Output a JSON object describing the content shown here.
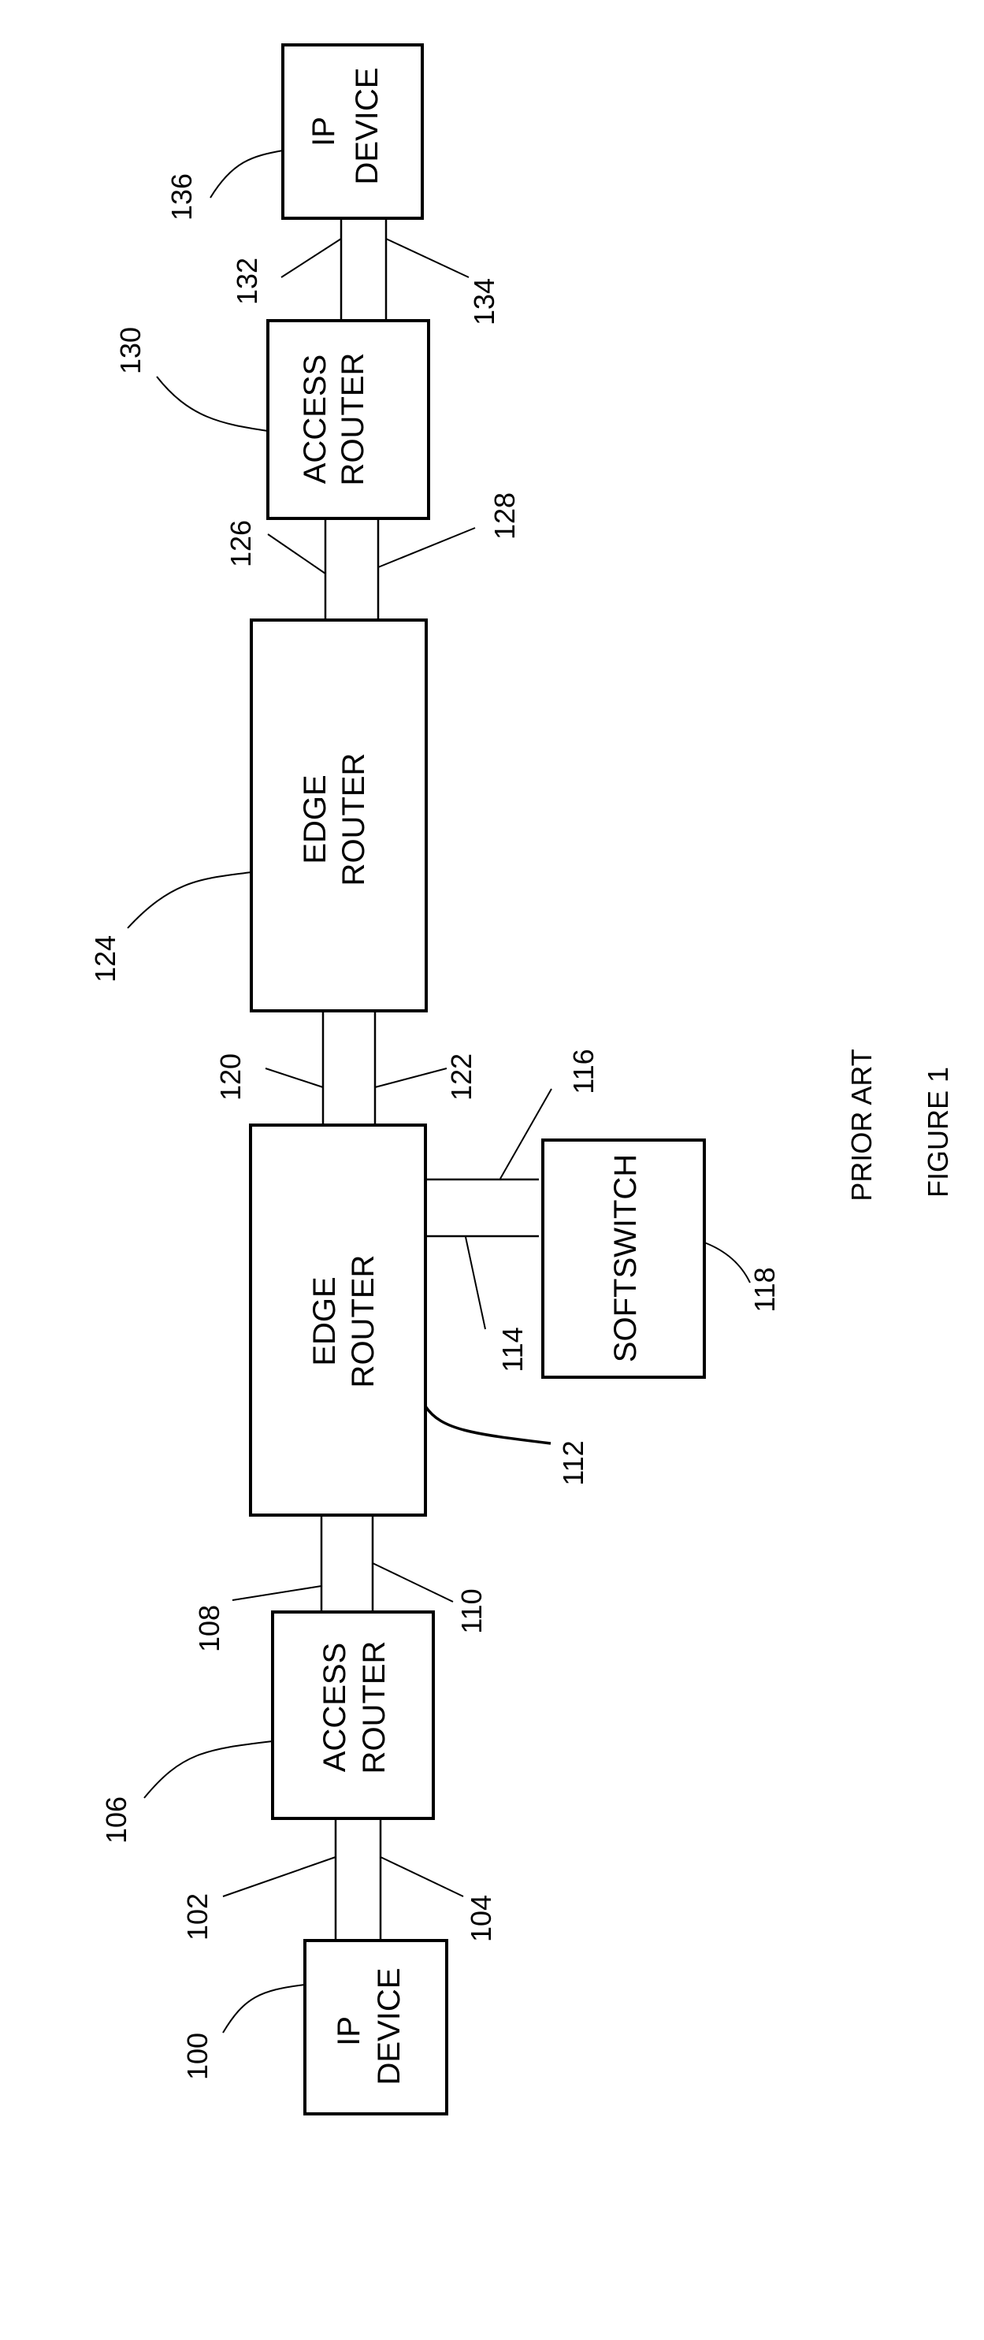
{
  "figure": {
    "title": "FIGURE 1",
    "subtitle": "PRIOR ART"
  },
  "nodes": {
    "ip_device_top": {
      "ref": "136",
      "lines": [
        "IP",
        "DEVICE"
      ]
    },
    "access_router_top": {
      "ref": "130",
      "lines": [
        "ACCESS",
        "ROUTER"
      ]
    },
    "edge_router_top": {
      "ref": "124",
      "lines": [
        "EDGE",
        "ROUTER"
      ]
    },
    "edge_router_bottom": {
      "ref": "112",
      "lines": [
        "EDGE",
        "ROUTER"
      ]
    },
    "softswitch": {
      "ref": "118",
      "lines": [
        "SOFTSWITCH"
      ]
    },
    "access_router_bottom": {
      "ref": "106",
      "lines": [
        "ACCESS",
        "ROUTER"
      ]
    },
    "ip_device_bottom": {
      "ref": "100",
      "lines": [
        "IP",
        "DEVICE"
      ]
    }
  },
  "links": {
    "ip_top_to_access_top": [
      "132",
      "134"
    ],
    "access_top_to_edge_top": [
      "126",
      "128"
    ],
    "edge_top_to_edge_bottom": [
      "120",
      "122"
    ],
    "edge_bottom_to_softswitch": [
      "116",
      "114"
    ],
    "edge_bottom_to_access_bottom": [
      "108",
      "110"
    ],
    "access_bottom_to_ip_bottom": [
      "102",
      "104"
    ]
  }
}
